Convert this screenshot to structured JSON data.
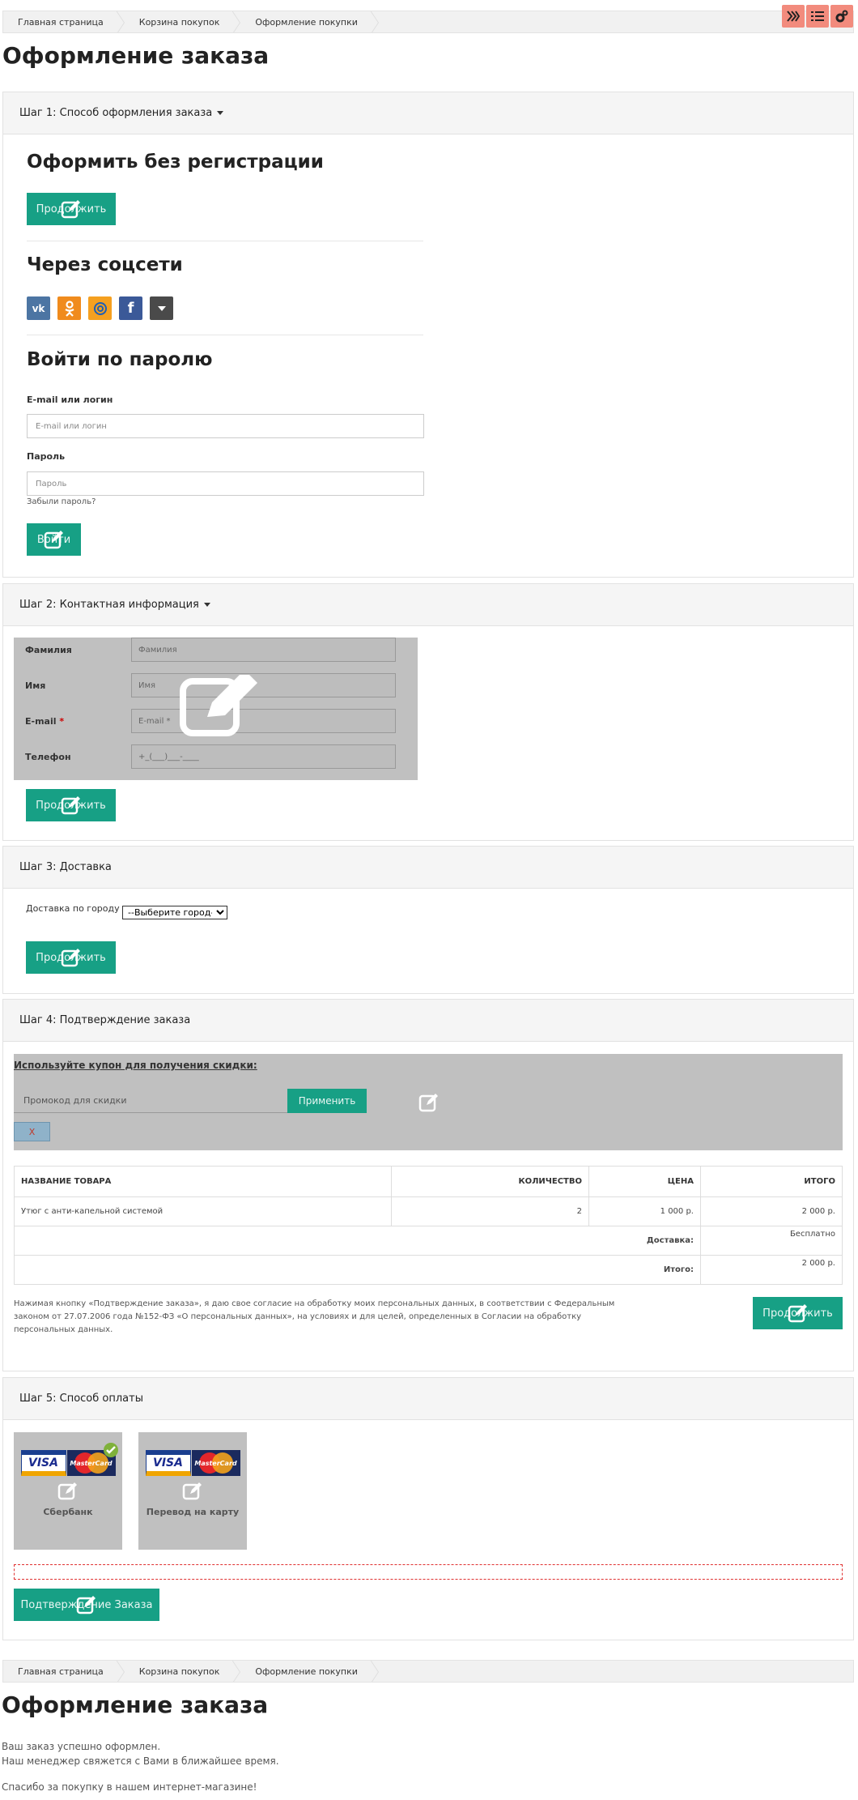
{
  "breadcrumb": [
    "Главная страница",
    "Корзина покупок",
    "Оформление покупки"
  ],
  "page_title": "Оформление заказа",
  "step1": {
    "title": "Шаг  1: Способ оформления заказа",
    "guest_heading": "Оформить без регистрации",
    "continue": "Продолжить",
    "social_heading": "Через соцсети",
    "social": [
      "vk-icon",
      "odnoklassniki-icon",
      "mailru-icon",
      "facebook-icon",
      "more-icon"
    ],
    "login_heading": "Войти по паролю",
    "login_label": "E-mail или логин",
    "login_placeholder": "E-mail или логин",
    "password_label": "Пароль",
    "password_placeholder": "Пароль",
    "forgot": "Забыли пароль?",
    "login_button": "Войти"
  },
  "step2": {
    "title": "Шаг  2: Контактная информация",
    "fields": [
      {
        "label": "Фамилия",
        "placeholder": "Фамилия",
        "required": false
      },
      {
        "label": "Имя",
        "placeholder": "Имя",
        "required": false
      },
      {
        "label": "E-mail",
        "placeholder": "E-mail *",
        "required": true
      },
      {
        "label": "Телефон",
        "placeholder": "+_(___)___-____",
        "required": false
      }
    ],
    "continue": "Продолжить"
  },
  "step3": {
    "title": "Шаг  3: Доставка",
    "delivery_label": "Доставка по городу",
    "city_selected": "--Выберите город--",
    "continue": "Продолжить"
  },
  "step4": {
    "title": "Шаг  4: Подтверждение заказа",
    "coupon_heading": "Используйте купон для получения скидки:",
    "coupon_placeholder": "Промокод для скидки",
    "apply": "Применить",
    "clear": "X",
    "table": {
      "headers": [
        "НАЗВАНИЕ ТОВАРА",
        "КОЛИЧЕСТВО",
        "ЦЕНА",
        "ИТОГО"
      ],
      "rows": [
        [
          "Утюг с анти-капельной системой",
          "2",
          "1 000 р.",
          "2 000 р."
        ]
      ],
      "delivery_label": "Доставка:",
      "delivery_value": "Бесплатно",
      "total_label": "Итого:",
      "total_value": "2 000 р."
    },
    "consent": "Нажимая кнопку «Подтверждение заказа», я даю свое согласие на обработку моих персональных данных, в соответствии с Федеральным законом от 27.07.2006 года №152-ФЗ «О персональных данных», на условиях и для целей, определенных в Согласии на обработку персональных данных.",
    "continue": "Продолжить"
  },
  "step5": {
    "title": "Шаг  5: Способ оплаты",
    "methods": [
      "Сбербанк",
      "Перевод на карту"
    ],
    "visa": "VISA",
    "mastercard": "MasterCard",
    "confirm": "Подтверждение Заказа"
  },
  "success": {
    "line1": "Ваш заказ успешно оформлен.",
    "line2": "Наш менеджер свяжется с Вами в ближайшее время.",
    "line3": "Спасибо за покупку в нашем интернет-магазине!"
  },
  "colors": {
    "accent": "#17a085",
    "admin": "#f28b7d"
  }
}
